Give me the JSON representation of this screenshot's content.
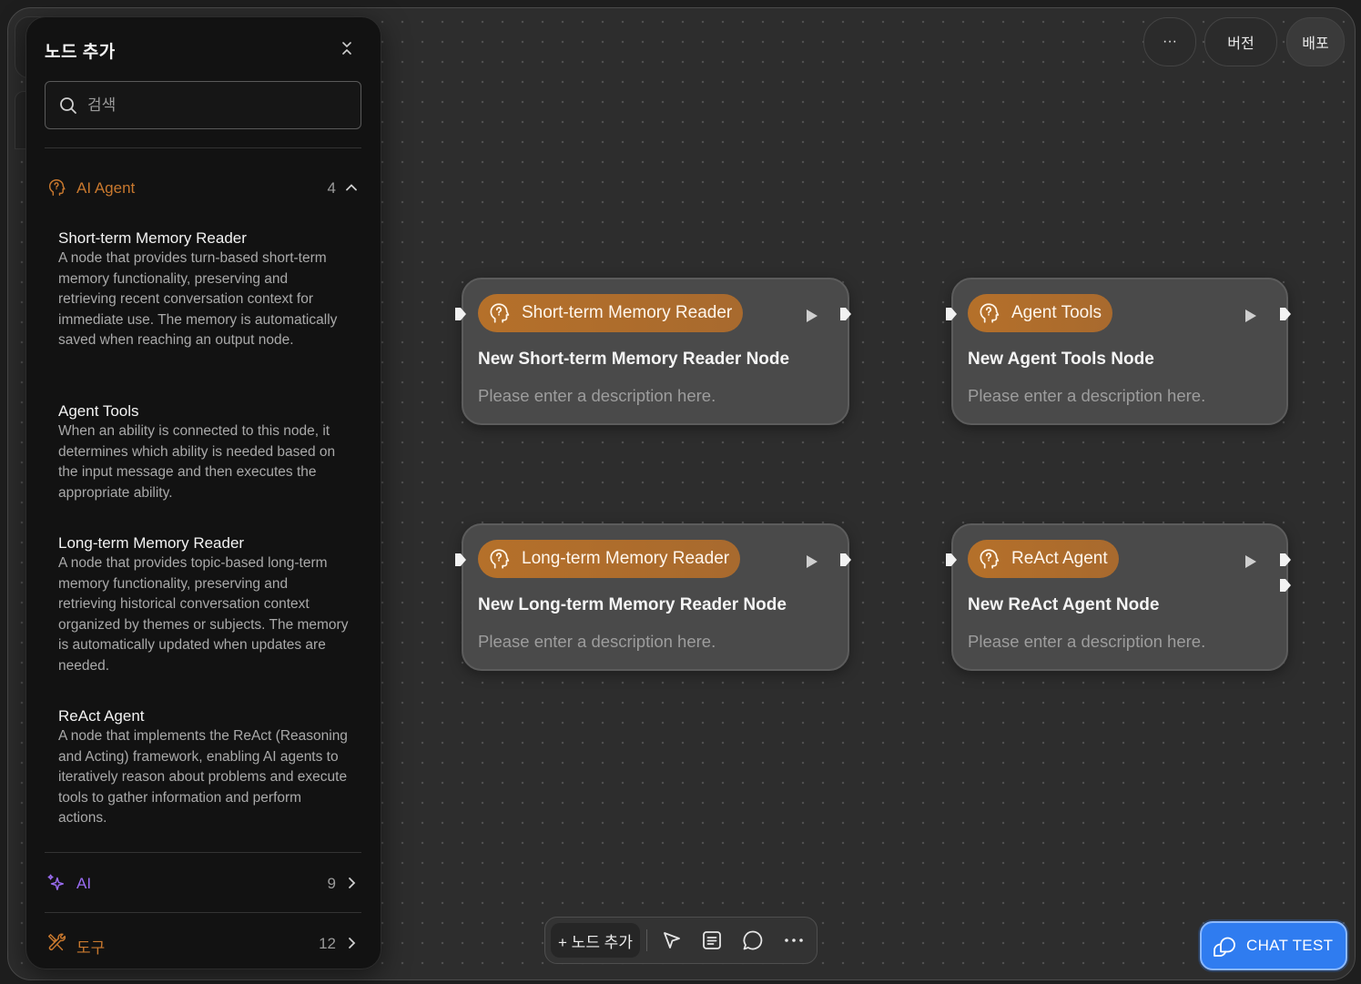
{
  "panel": {
    "title": "노드 추가",
    "search_placeholder": "검색",
    "categories": [
      {
        "label": "AI Agent",
        "count": "4",
        "icon": "agent-head-icon",
        "color": "#c8782e",
        "expanded": true
      },
      {
        "label": "AI",
        "count": "9",
        "icon": "sparkle-icon",
        "color": "#9a6cf2"
      },
      {
        "label": "도구",
        "count": "12",
        "icon": "tools-icon",
        "color": "#c8782e"
      }
    ],
    "items": [
      {
        "title": "Short-term Memory Reader",
        "desc": "A node that provides turn-based short-term memory functionality, preserving and retrieving recent conversation context for immediate use. The memory is automatically saved when reaching an output node."
      },
      {
        "title": "Agent Tools",
        "desc": "When an ability is connected to this node, it determines which ability is needed based on the input message and then executes the appropriate ability."
      },
      {
        "title": "Long-term Memory Reader",
        "desc": "A node that provides topic-based long-term memory functionality, preserving and retrieving historical conversation context organized by themes or subjects. The memory is automatically updated when updates are needed."
      },
      {
        "title": "ReAct Agent",
        "desc": "A node that implements the ReAct (Reasoning and Acting) framework, enabling AI agents to iteratively reason about problems and execute tools to gather information and perform actions."
      }
    ]
  },
  "topbar": {
    "more_label": "···",
    "version_label": "버전",
    "deploy_label": "배포"
  },
  "nodes": [
    {
      "type": "Short-term Memory Reader",
      "title": "New Short-term Memory Reader Node",
      "description": "Please enter a description here."
    },
    {
      "type": "Agent Tools",
      "title": "New Agent Tools Node",
      "description": "Please enter a description here."
    },
    {
      "type": "Long-term Memory Reader",
      "title": "New Long-term Memory Reader Node",
      "description": "Please enter a description here."
    },
    {
      "type": "ReAct Agent",
      "title": "New ReAct Agent Node",
      "description": "Please enter a description here."
    }
  ],
  "toolbar": {
    "add_label": "+ 노드 추가"
  },
  "chat_test": {
    "label": "CHAT TEST",
    "color": "#2f7cf0"
  },
  "colors": {
    "accent_orange": "#b5702a",
    "ai_purple": "#9a6cf2"
  }
}
